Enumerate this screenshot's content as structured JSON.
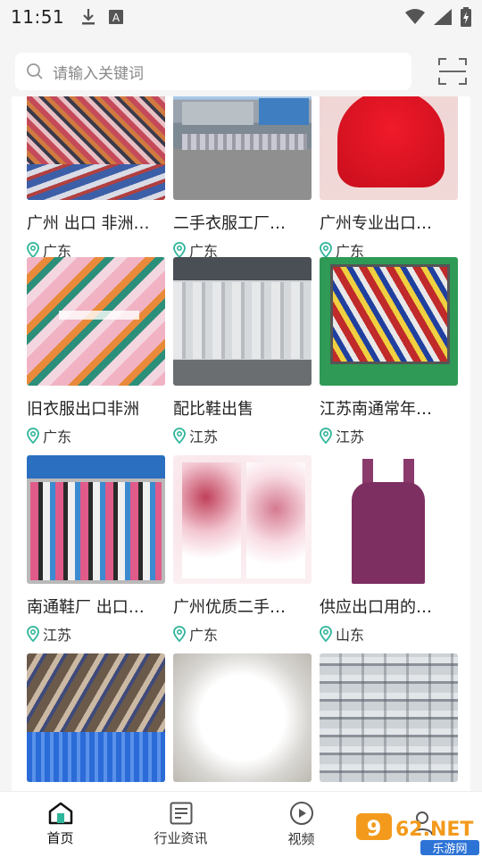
{
  "status_bar": {
    "time": "11:51"
  },
  "search": {
    "placeholder": "请输入关键词"
  },
  "items": [
    {
      "title": "广州 出口 非洲…",
      "location": "广东"
    },
    {
      "title": "二手衣服工厂…",
      "location": "广东"
    },
    {
      "title": "广州专业出口…",
      "location": "广东"
    },
    {
      "title": "旧衣服出口非洲",
      "location": "广东"
    },
    {
      "title": "配比鞋出售",
      "location": "江苏"
    },
    {
      "title": "江苏南通常年…",
      "location": "江苏"
    },
    {
      "title": "南通鞋厂 出口…",
      "location": "江苏"
    },
    {
      "title": "广州优质二手…",
      "location": "广东"
    },
    {
      "title": "供应出口用的…",
      "location": "山东"
    },
    {
      "title": "",
      "location": ""
    },
    {
      "title": "",
      "location": ""
    },
    {
      "title": "",
      "location": ""
    }
  ],
  "nav": {
    "home": "首页",
    "news": "行业资讯",
    "video": "视频"
  },
  "watermark": {
    "text": "962.NET",
    "subtext": "乐游网"
  },
  "colors": {
    "accent": "#2fb59a",
    "icon": "#555555"
  }
}
